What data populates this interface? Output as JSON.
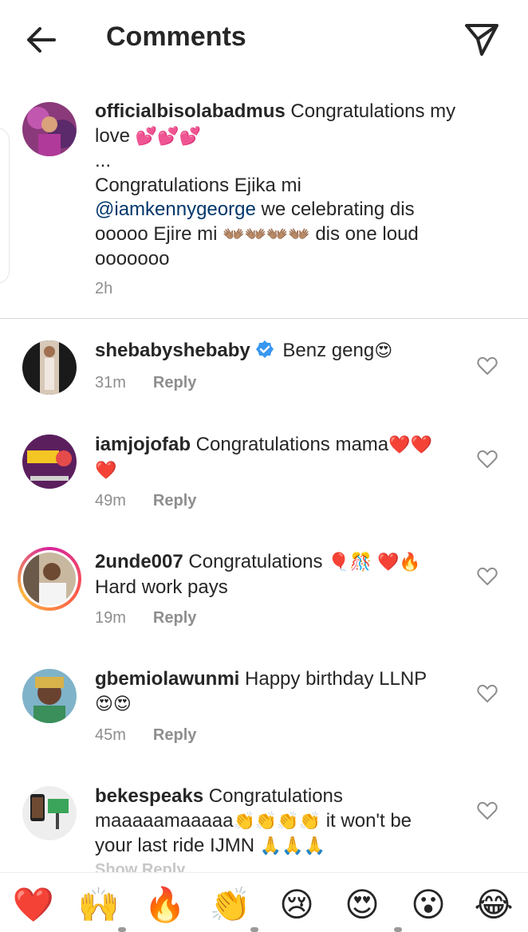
{
  "header": {
    "title": "Comments"
  },
  "caption": {
    "username": "officialbisolabadmus",
    "line1": " Congratulations my",
    "line2_text": "love ",
    "line2_emoji": "💕💕💕",
    "line3": "...",
    "line4": "Congratulations Ejika mi",
    "mention": "@iamkennygeorge",
    "line5_rest": "  we celebrating dis",
    "line6_text": "ooooo Ejire mi ",
    "line6_emoji": "👐🏽👐🏽👐🏽👐🏽",
    "line6_rest": " dis one loud",
    "line7": "ooooooo",
    "time": "2h"
  },
  "comments": [
    {
      "username": "shebabyshebaby",
      "verified": true,
      "text": " Benz geng",
      "emoji": "😍",
      "time": "31m",
      "reply": "Reply"
    },
    {
      "username": "iamjojofab",
      "text": " Congratulations mama",
      "emoji": "❤️❤️",
      "text2_emoji": "❤️",
      "time": "49m",
      "reply": "Reply"
    },
    {
      "username": "2unde007",
      "text": " Congratulations ",
      "emoji": "🎈🎊 ❤️🔥",
      "text2": "Hard work pays",
      "time": "19m",
      "reply": "Reply"
    },
    {
      "username": "gbemiolawunmi",
      "text": " Happy birthday LLNP",
      "text2_emoji": "😍😍",
      "time": "45m",
      "reply": "Reply"
    },
    {
      "username": "bekespeaks",
      "text": " Congratulations",
      "line2_text": "maaaaamaaaaa",
      "line2_emoji": "👏👏👏👏",
      "line2_rest": " it won't be",
      "line3_text": "your last ride IJMN ",
      "line3_emoji": "🙏🙏🙏",
      "time": "Show",
      "reply": "Reply"
    }
  ],
  "emoji_bar": [
    "❤️",
    "🙌",
    "🔥",
    "👏",
    "😢",
    "😍",
    "😮",
    "😂"
  ],
  "icons": {
    "back": "arrow-left-icon",
    "send": "paper-plane-icon",
    "like": "heart-outline-icon",
    "verified": "verified-badge-icon"
  },
  "colors": {
    "mention": "#00376b",
    "muted": "#8e8e8e",
    "verified": "#3897f0"
  }
}
